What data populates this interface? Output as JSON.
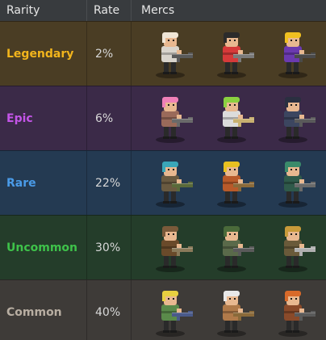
{
  "header": {
    "rarity": "Rarity",
    "rate": "Rate",
    "mercs": "Mercs"
  },
  "rows": [
    {
      "rarity": "Legendary",
      "rate": "2%",
      "color": "#f2b51c",
      "bg": "#4a3d24",
      "mercs": [
        {
          "icon": "merc-white-armor-gunner-icon",
          "hair": "#f0e6d6",
          "body": "#d9d4cc",
          "gun": "#5a5a5a"
        },
        {
          "icon": "merc-red-pistols-girl-icon",
          "hair": "#2b2b2b",
          "body": "#d63a3a",
          "gun": "#7a7a7a"
        },
        {
          "icon": "merc-purple-mage-gunner-icon",
          "hair": "#f0c020",
          "body": "#6b3ab0",
          "gun": "#4a4a4a"
        }
      ]
    },
    {
      "rarity": "Epic",
      "rate": "6%",
      "color": "#c455e8",
      "bg": "#3b2a48",
      "mercs": [
        {
          "icon": "merc-pink-hair-minigunner-icon",
          "hair": "#f080b8",
          "body": "#9a6a5a",
          "gun": "#6a6a6a"
        },
        {
          "icon": "merc-green-hair-dual-sword-icon",
          "hair": "#8ad040",
          "body": "#dcdcdc",
          "gun": "#c8b070"
        },
        {
          "icon": "merc-navy-riot-soldier-icon",
          "hair": "#2a2f40",
          "body": "#3c4660",
          "gun": "#5a5a5a"
        }
      ]
    },
    {
      "rarity": "Rare",
      "rate": "22%",
      "color": "#4a9be8",
      "bg": "#243a52",
      "mercs": [
        {
          "icon": "merc-teal-hair-bazooka-icon",
          "hair": "#3aa6b8",
          "body": "#6a5a40",
          "gun": "#5a6a3a"
        },
        {
          "icon": "merc-yellow-hat-gunner-icon",
          "hair": "#e8c020",
          "body": "#b85a2a",
          "gun": "#8a6a3a"
        },
        {
          "icon": "merc-green-turret-icon",
          "hair": "#3a8a6a",
          "body": "#2f5a4a",
          "gun": "#6a6a6a"
        }
      ]
    },
    {
      "rarity": "Uncommon",
      "rate": "30%",
      "color": "#3ec24a",
      "bg": "#243d2a",
      "mercs": [
        {
          "icon": "merc-brown-hood-sniper-icon",
          "hair": "#7a5a3a",
          "body": "#6a4a2a",
          "gun": "#8a7a5a"
        },
        {
          "icon": "merc-green-helmet-rifleman-icon",
          "hair": "#4a6a3a",
          "body": "#5a6a4a",
          "gun": "#5a5a5a"
        },
        {
          "icon": "merc-camo-knife-soldier-icon",
          "hair": "#c89a3a",
          "body": "#6a5a3a",
          "gun": "#b0b0b0"
        }
      ]
    },
    {
      "rarity": "Common",
      "rate": "40%",
      "color": "#b8aea2",
      "bg": "#3e3b38",
      "mercs": [
        {
          "icon": "merc-blond-heavy-gunner-icon",
          "hair": "#e8d040",
          "body": "#5a8a4a",
          "gun": "#4a5a8a"
        },
        {
          "icon": "merc-white-cap-rifleman-icon",
          "hair": "#e8e8e8",
          "body": "#b07a4a",
          "gun": "#8a6a3a"
        },
        {
          "icon": "merc-orange-mech-icon",
          "hair": "#d86a2a",
          "body": "#8a4a2a",
          "gun": "#5a5a5a"
        }
      ]
    }
  ]
}
